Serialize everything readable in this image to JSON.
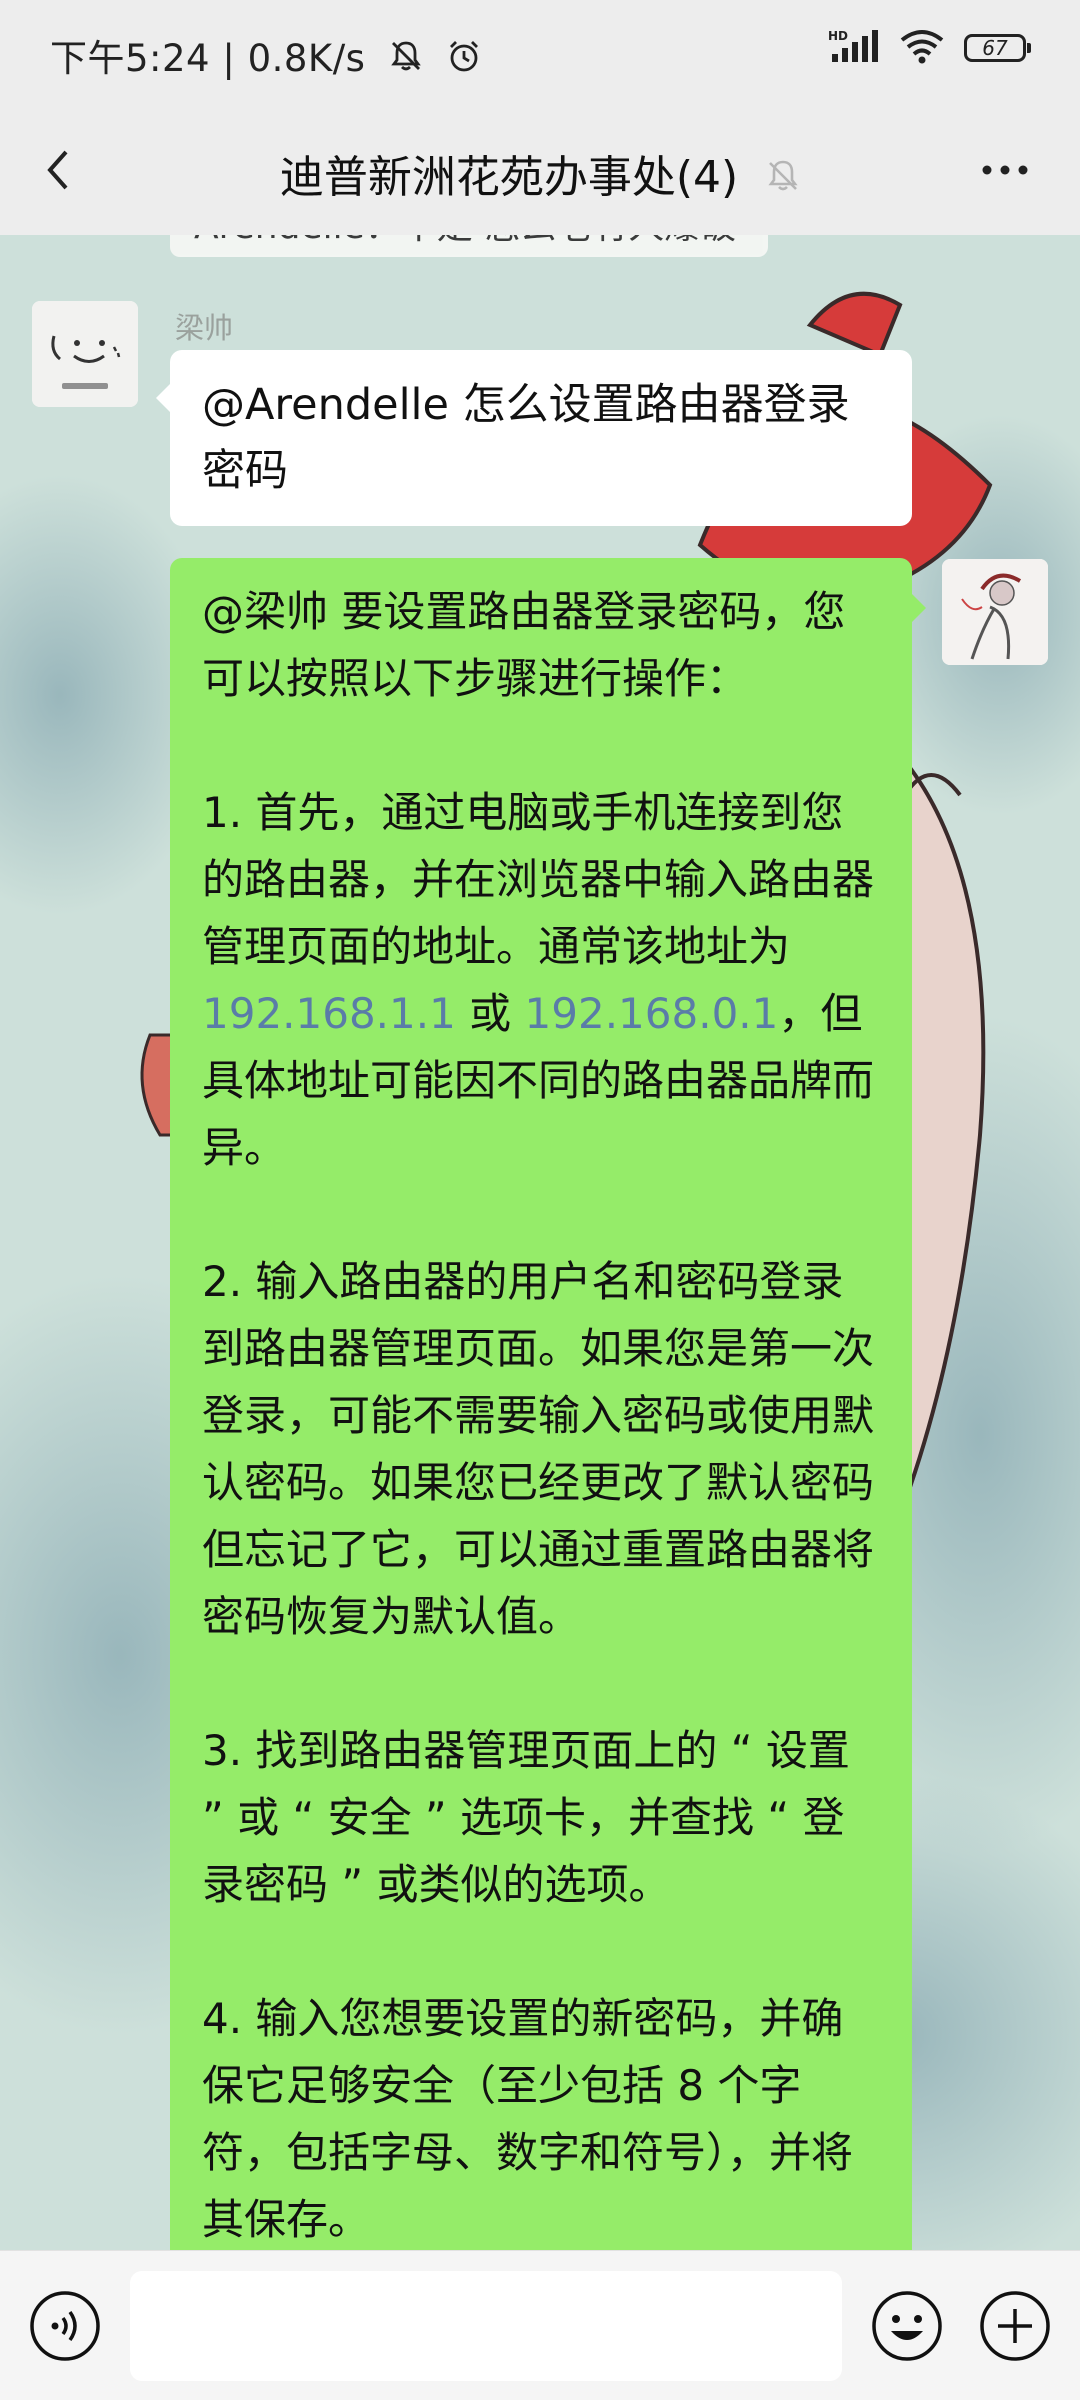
{
  "status_bar": {
    "time": "下午5:24",
    "network_speed": "0.8K/s",
    "battery": "67",
    "icons": [
      "mute-notification-icon",
      "alarm-icon",
      "hd-signal-icon",
      "wifi-icon",
      "battery-icon"
    ]
  },
  "header": {
    "title": "迪普新洲花苑办事处(4)",
    "icons": [
      "back-arrow-icon",
      "mute-bell-icon",
      "more-icon"
    ]
  },
  "messages": {
    "previous": "Arendelle：不是 怎么老有人爆破",
    "incoming": {
      "sender": "梁帅",
      "text": "@Arendelle  怎么设置路由器登录密码"
    },
    "outgoing": {
      "intro": "@梁帅 要设置路由器登录密码，您可以按照以下步骤进行操作：",
      "step1_before": "1. 首先，通过电脑或手机连接到您的路由器，并在浏览器中输入路由器管理页面的地址。通常该地址为 ",
      "step1_link1": "192.168.1.1",
      "step1_or": " 或 ",
      "step1_link2": "192.168.0.1",
      "step1_after": "，但具体地址可能因不同的路由器品牌而异。",
      "step2": "2. 输入路由器的用户名和密码登录到路由器管理页面。如果您是第一次登录，可能不需要输入密码或使用默认密码。如果您已经更改了默认密码但忘记了它，可以通过重置路由器将密码恢复为默认值。",
      "step3": "3. 找到路由器管理页面上的 “ 设置 ” 或 “ 安全 ” 选项卡，并查找 “ 登录密码 ” 或类似的选项。",
      "step4": "4. 输入您想要设置的新密码，并确保它足够安全（至少包括 8 个字符，包括字母、数字和符号），并将其保存。"
    }
  },
  "input_bar": {
    "text_value": "",
    "icons": [
      "voice-icon",
      "emoji-icon",
      "plus-icon"
    ]
  },
  "colors": {
    "outgoing_bubble": "#95ec69",
    "incoming_bubble": "#ffffff",
    "bar_background": "#ededed",
    "link": "#5a7ca8"
  }
}
